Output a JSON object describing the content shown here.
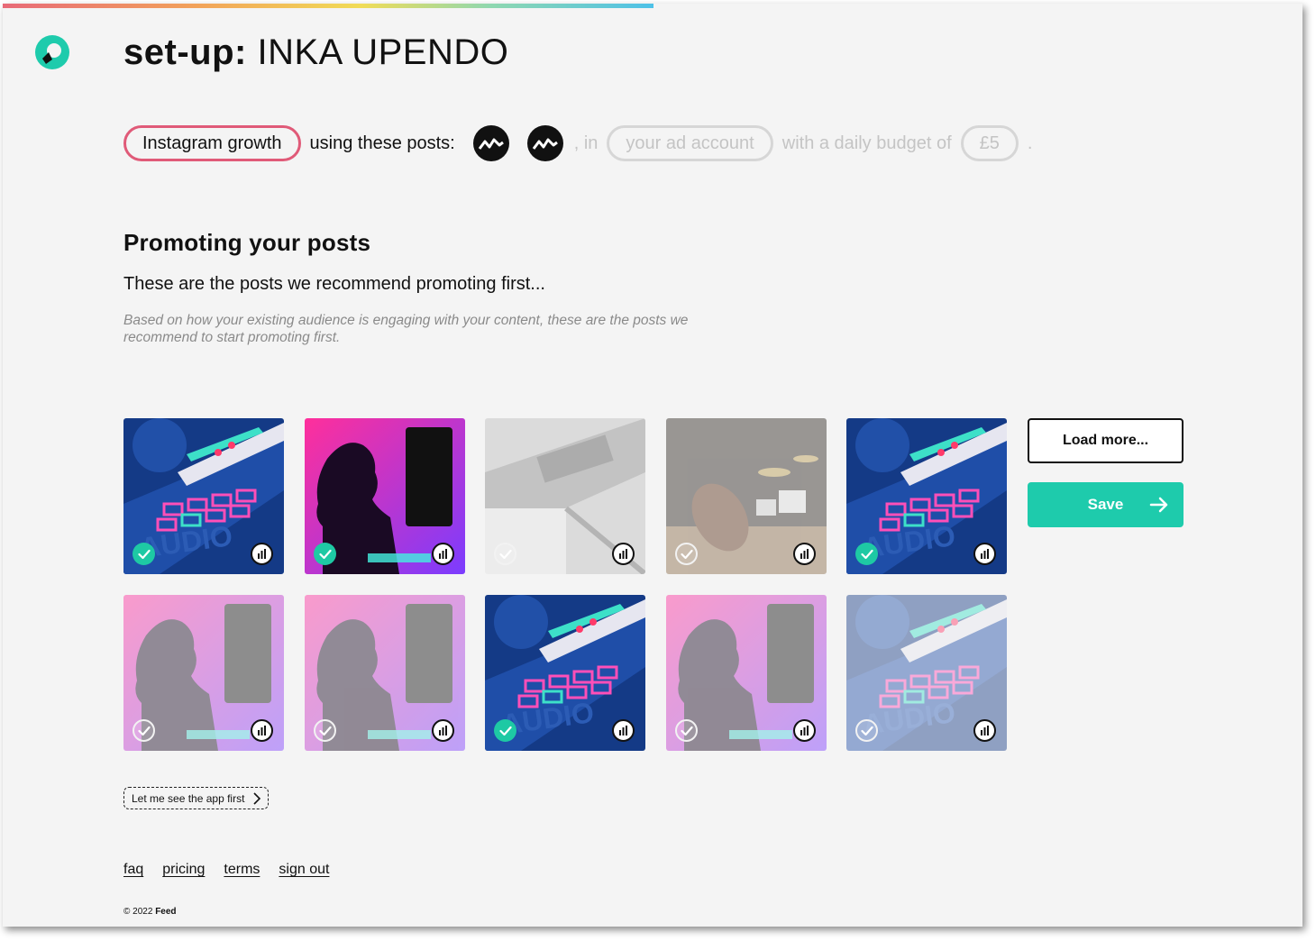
{
  "header": {
    "title_prefix": "set-up:",
    "title_name": "INKA UPENDO"
  },
  "summary": {
    "goal": "Instagram growth",
    "posts_text": "using these posts:",
    "in_text": ", in",
    "ad_account_placeholder": "your ad account",
    "budget_text": "with a daily budget of",
    "budget_value": "£5",
    "end_text": "."
  },
  "section": {
    "title": "Promoting your posts",
    "subtitle": "These are the posts we recommend promoting first...",
    "description": "Based on how your existing audience is engaging with your content, these are the posts we recommend to start promoting first."
  },
  "posts": [
    {
      "image": "midi-controller",
      "selected": true
    },
    {
      "image": "person-silhouette-pink",
      "selected": true
    },
    {
      "image": "audio-interface",
      "selected": false
    },
    {
      "image": "violin-and-drums",
      "selected": false
    },
    {
      "image": "midi-controller",
      "selected": true
    },
    {
      "image": "person-silhouette-pink",
      "selected": false
    },
    {
      "image": "person-silhouette-pink",
      "selected": false
    },
    {
      "image": "midi-controller",
      "selected": true
    },
    {
      "image": "person-silhouette-pink",
      "selected": false
    },
    {
      "image": "midi-controller",
      "selected": false
    }
  ],
  "actions": {
    "load_more": "Load more...",
    "save": "Save",
    "skip": "Let me see the app first"
  },
  "footer": {
    "links": [
      "faq",
      "pricing",
      "terms",
      "sign out"
    ],
    "copyright_prefix": "© 2022",
    "copyright_brand": "Feed"
  },
  "colors": {
    "accent": "#1ecbac",
    "goal_border": "#e05a78",
    "background": "#f4f4f4"
  }
}
